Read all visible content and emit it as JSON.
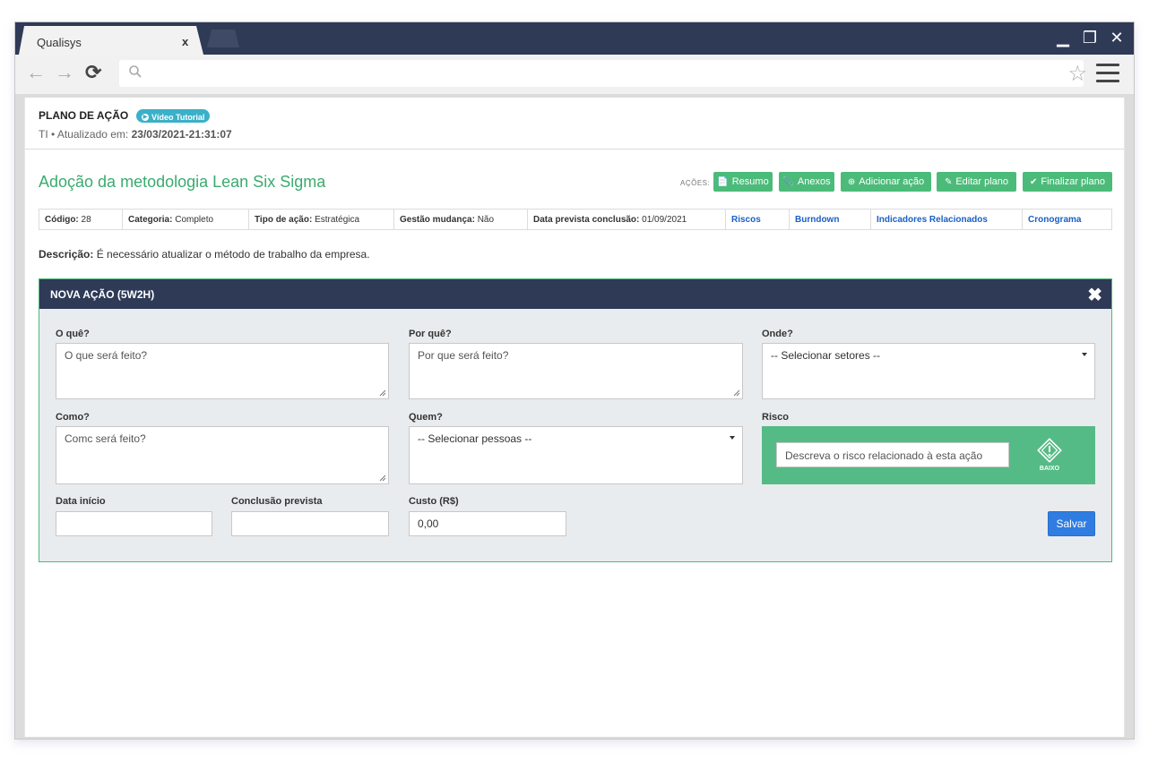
{
  "browser": {
    "tab_title": "Qualisys",
    "tab_close": "x",
    "win_minimize": "▁",
    "win_restore": "❐",
    "win_close": "✕",
    "nav_back": "←",
    "nav_forward": "→",
    "nav_reload": "⟳",
    "star": "☆"
  },
  "header": {
    "title": "PLANO DE AÇÃO",
    "badge": "Vídeo Tutorial",
    "sub_prefix": "TI • Atualizado em: ",
    "updated_at": "23/03/2021-21:31:07"
  },
  "plan": {
    "title": "Adoção da metodologia Lean Six Sigma",
    "actions_label": "AÇÕES:",
    "buttons": [
      {
        "label": "Resumo",
        "icon": "📄"
      },
      {
        "label": "Anexos",
        "icon": "📎"
      },
      {
        "label": "Adicionar ação",
        "icon": "⊕"
      },
      {
        "label": "Editar plano",
        "icon": "✎"
      },
      {
        "label": "Finalizar plano",
        "icon": "✔"
      }
    ]
  },
  "info": {
    "codigo_label": "Código:",
    "codigo": "28",
    "categoria_label": "Categoria:",
    "categoria": "Completo",
    "tipo_label": "Tipo de ação:",
    "tipo": "Estratégica",
    "gestao_label": "Gestão mudança:",
    "gestao": "Não",
    "data_label": "Data prevista conclusão:",
    "data": "01/09/2021",
    "links": [
      "Riscos",
      "Burndown",
      "Indicadores Relacionados",
      "Cronograma"
    ]
  },
  "description": {
    "label": "Descrição:",
    "text": "É necessário atualizar o método de trabalho da empresa."
  },
  "form": {
    "title": "NOVA AÇÃO (5W2H)",
    "close": "✖",
    "o_que_label": "O quê?",
    "o_que_placeholder": "O que será feito?",
    "por_que_label": "Por quê?",
    "por_que_placeholder": "Por que será feito?",
    "onde_label": "Onde?",
    "onde_value": "-- Selecionar setores --",
    "como_label": "Como?",
    "como_placeholder": "Comc será feito?",
    "quem_label": "Quem?",
    "quem_value": "-- Selecionar pessoas --",
    "risco_label": "Risco",
    "risco_placeholder": "Descreva o risco relacionado à esta ação",
    "risco_level": "BAIXO",
    "data_inicio_label": "Data início",
    "data_inicio_value": "",
    "conclusao_label": "Conclusão prevista",
    "conclusao_value": "",
    "custo_label": "Custo (R$)",
    "custo_value": "0,00",
    "save_label": "Salvar"
  }
}
